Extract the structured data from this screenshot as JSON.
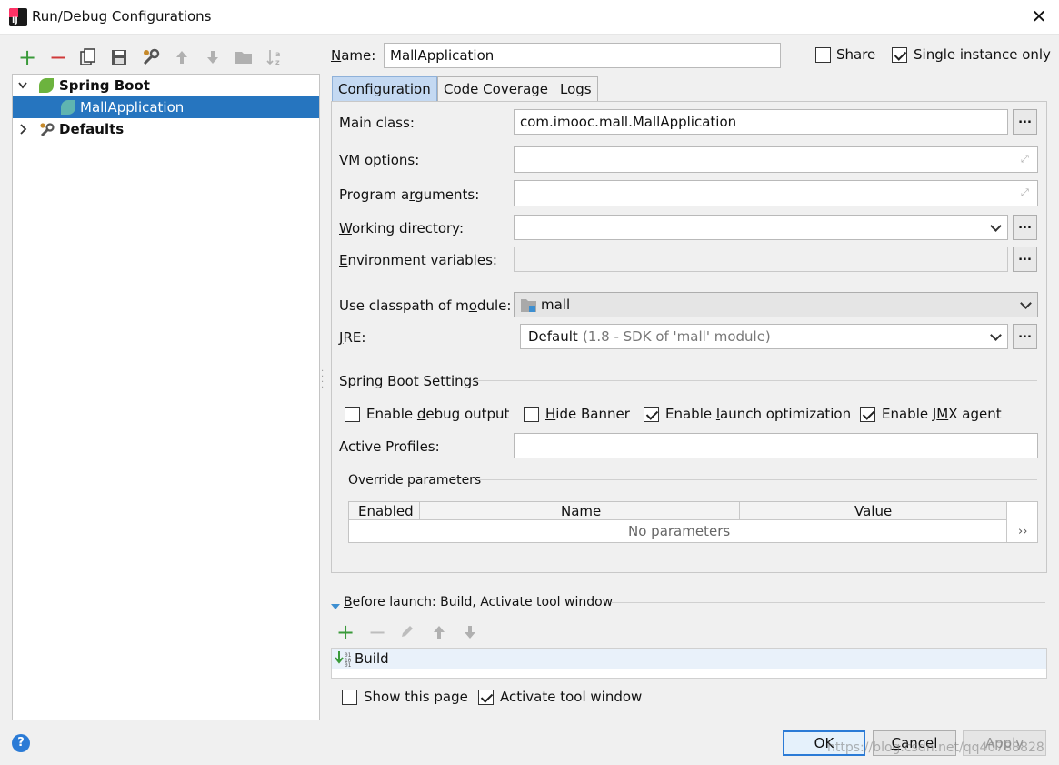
{
  "window": {
    "title": "Run/Debug Configurations"
  },
  "toolbar": {
    "icons": [
      "add-icon",
      "remove-icon",
      "copy-icon",
      "save-icon",
      "wrench-icon",
      "move-up-icon",
      "move-down-icon",
      "folder-icon",
      "sort-icon"
    ]
  },
  "tree": {
    "items": [
      {
        "label": "Spring Boot",
        "expanded": true,
        "bold": true
      },
      {
        "label": "MallApplication",
        "selected": true
      },
      {
        "label": "Defaults",
        "expanded": false,
        "bold": true
      }
    ]
  },
  "header": {
    "name_label": "Name:",
    "name_value": "MallApplication",
    "share_label": "Share",
    "share_checked": false,
    "single_instance_label": "Single instance only",
    "single_instance_checked": true
  },
  "tabs": [
    {
      "label": "Configuration",
      "active": true
    },
    {
      "label": "Code Coverage",
      "active": false
    },
    {
      "label": "Logs",
      "active": false
    }
  ],
  "config": {
    "main_class_label": "Main class:",
    "main_class_value": "com.imooc.mall.MallApplication",
    "vm_options_label": "VM options:",
    "vm_options_value": "",
    "program_args_label": "Program arguments:",
    "program_args_value": "",
    "working_dir_label": "Working directory:",
    "working_dir_value": "",
    "env_vars_label": "Environment variables:",
    "env_vars_value": "",
    "classpath_label": "Use classpath of module:",
    "classpath_value": "mall",
    "jre_label": "JRE:",
    "jre_value": "Default",
    "jre_detail": "(1.8 - SDK of 'mall' module)",
    "dots": "..."
  },
  "spring_boot": {
    "section_label": "Spring Boot Settings",
    "debug_output_label": "Enable debug output",
    "debug_output_checked": false,
    "hide_banner_label": "Hide Banner",
    "hide_banner_checked": false,
    "launch_opt_label": "Enable launch optimization",
    "launch_opt_checked": true,
    "jmx_label": "Enable JMX agent",
    "jmx_checked": true,
    "active_profiles_label": "Active Profiles:",
    "active_profiles_value": "",
    "override_label": "Override parameters",
    "table_headers": [
      "Enabled",
      "Name",
      "Value"
    ],
    "empty_text": "No parameters",
    "more_glyph": "››"
  },
  "before_launch": {
    "label": "Before launch: Build, Activate tool window",
    "items": [
      "Build"
    ],
    "show_page_label": "Show this page",
    "show_page_checked": false,
    "activate_tool_label": "Activate tool window",
    "activate_tool_checked": true
  },
  "footer": {
    "ok_label": "OK",
    "cancel_label": "Cancel",
    "apply_label": "Apply",
    "help_glyph": "?",
    "watermark": "https://blog.csdn.net/qq40788828"
  },
  "colors": {
    "selection": "#2675bf",
    "tab_active": "#c4d9f2",
    "default_button_border": "#2b7bd6",
    "add_green": "#3a9a3a",
    "remove_red": "#d03a3a"
  }
}
